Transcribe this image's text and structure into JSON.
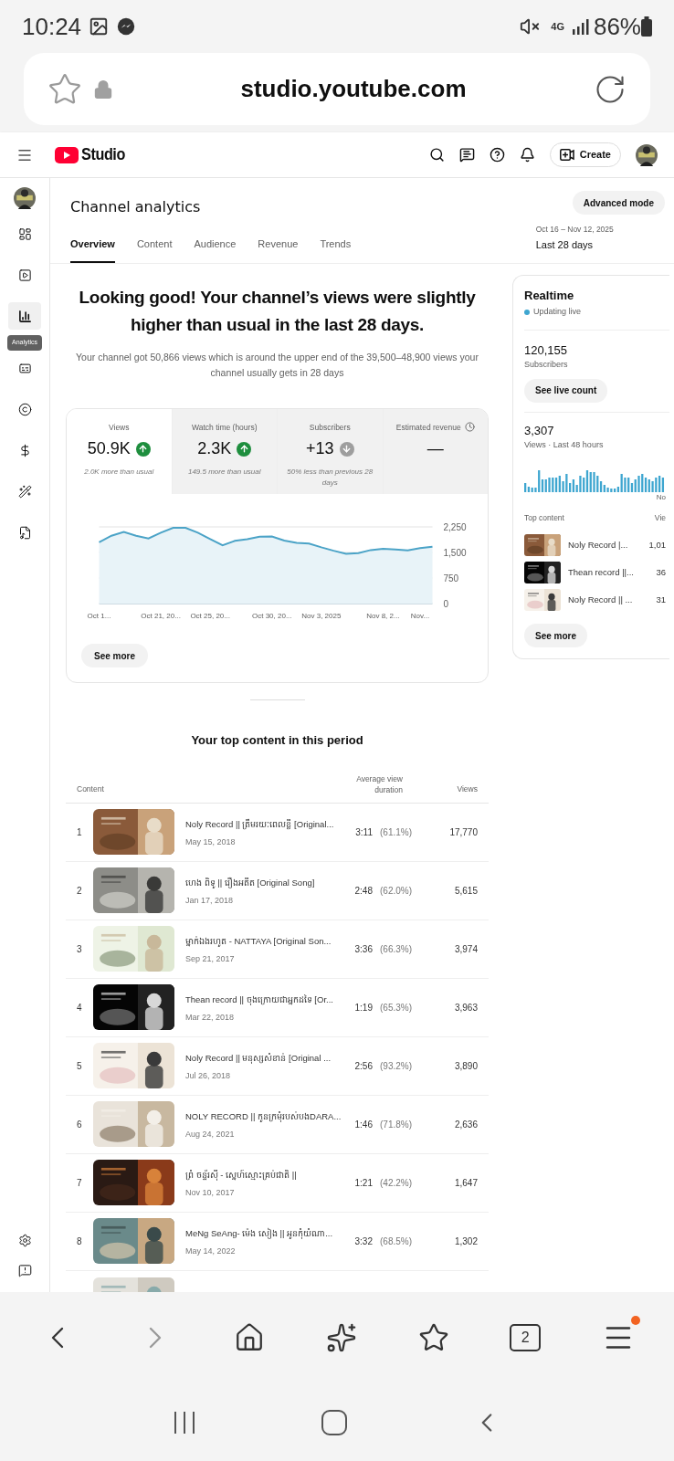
{
  "status_bar": {
    "time": "10:24",
    "network": "4G",
    "battery": "86%"
  },
  "address_bar": {
    "url": "studio.youtube.com"
  },
  "header": {
    "logo": "Studio",
    "create_button": "Create"
  },
  "sidebar": {
    "tooltip": "Analytics",
    "items": [
      {
        "kind": "dashboard",
        "selected": false
      },
      {
        "kind": "content",
        "selected": false
      },
      {
        "kind": "analytics",
        "selected": true
      },
      {
        "kind": "subtitles",
        "selected": false
      },
      {
        "kind": "copyright",
        "selected": false
      },
      {
        "kind": "earn",
        "selected": false
      },
      {
        "kind": "customization",
        "selected": false
      },
      {
        "kind": "audio",
        "selected": false
      }
    ],
    "footer_items": [
      {
        "kind": "settings"
      },
      {
        "kind": "feedback"
      }
    ]
  },
  "page": {
    "title": "Channel analytics",
    "advanced_button": "Advanced mode",
    "date_range": "Oct 16 – Nov 12, 2025",
    "period": "Last 28 days",
    "tabs": [
      {
        "label": "Overview",
        "selected": true
      },
      {
        "label": "Content",
        "selected": false
      },
      {
        "label": "Audience",
        "selected": false
      },
      {
        "label": "Revenue",
        "selected": false
      },
      {
        "label": "Trends",
        "selected": false
      }
    ]
  },
  "summary": {
    "headline": "Looking good! Your channel’s views were slightly higher than usual in the last 28 days.",
    "description": "Your channel got 50,866 views which is around the upper end of the 39,500–48,900 views your channel usually gets in 28 days"
  },
  "stats": [
    {
      "label": "Views",
      "value": "50.9K",
      "rising": true,
      "falling": false,
      "note": "2.0K more than usual",
      "clock": false,
      "selected": true
    },
    {
      "label": "Watch time (hours)",
      "value": "2.3K",
      "rising": true,
      "falling": false,
      "note": "149.5 more than usual",
      "clock": false,
      "selected": false
    },
    {
      "label": "Subscribers",
      "value": "+13",
      "rising": false,
      "falling": true,
      "note": "50% less than previous 28 days",
      "clock": false,
      "selected": false
    },
    {
      "label": "Estimated revenue",
      "value": "—",
      "rising": false,
      "falling": false,
      "clock": true,
      "selected": false
    }
  ],
  "chart_data": {
    "type": "area",
    "categories": [
      "Oct 1...",
      null,
      null,
      null,
      null,
      "Oct 21, 20...",
      null,
      null,
      null,
      "Oct 25, 20...",
      null,
      null,
      null,
      null,
      "Oct 30, 20...",
      null,
      null,
      null,
      "Nov 3, 2025",
      null,
      null,
      null,
      null,
      "Nov 8, 2...",
      null,
      null,
      "Nov...",
      null
    ],
    "series": [
      {
        "color": "#4ba3c7",
        "values": [
          1800,
          1990,
          2100,
          1990,
          1910,
          2080,
          2220,
          2220,
          2080,
          1890,
          1710,
          1840,
          1890,
          1960,
          1970,
          1850,
          1780,
          1760,
          1650,
          1550,
          1460,
          1480,
          1570,
          1610,
          1590,
          1560,
          1630,
          1670
        ]
      }
    ],
    "ylim": [
      0,
      2250
    ],
    "yticks": [
      {
        "value": 0,
        "label": "0"
      },
      {
        "value": 750,
        "label": "750"
      },
      {
        "value": 1500,
        "label": "1,500"
      },
      {
        "value": 2250,
        "label": "2,250"
      }
    ]
  },
  "see_more": "See more",
  "realtime": {
    "title": "Realtime",
    "status": "Updating live",
    "subscribers": "120,155",
    "subscribers_label": "Subscribers",
    "live_button": "See live count",
    "views": "3,307",
    "views_label": "Views · Last 48 hours",
    "axis_label": "No",
    "columns": [
      "Top content",
      "Vie"
    ],
    "rows": [
      {
        "title": "Noly Record |...",
        "views": "1,01"
      },
      {
        "title": "Thean record ||...",
        "views": "36"
      },
      {
        "title": "Noly Record || ...",
        "views": "31"
      }
    ],
    "see_more": "See more"
  },
  "top_content": {
    "title": "Your top content in this period",
    "columns": [
      "Content",
      "Average view duration",
      "Views"
    ],
    "rows": [
      {
        "rank": "1",
        "title": "Noly Record || ត្រឹមរយៈពេលខ្លី [Original...",
        "date": "May 15, 2018",
        "duration": "3:11",
        "percent": "(61.1%)",
        "views": "17,770"
      },
      {
        "rank": "2",
        "title": "ហេង ពិទូ || រឿងអតីត [Original Song]",
        "date": "Jan 17, 2018",
        "duration": "2:48",
        "percent": "(62.0%)",
        "views": "5,615"
      },
      {
        "rank": "3",
        "title": "ម្នាក់ឯងរហូត - NATTAYA [Original Son...",
        "date": "Sep 21, 2017",
        "duration": "3:36",
        "percent": "(66.3%)",
        "views": "3,974"
      },
      {
        "rank": "4",
        "title": "Thean record || ចុងក្រោយជាអ្នកដទៃ [Or...",
        "date": "Mar 22, 2018",
        "duration": "1:19",
        "percent": "(65.3%)",
        "views": "3,963"
      },
      {
        "rank": "5",
        "title": "Noly Record || មនុស្សសំខាន់ [Original ...",
        "date": "Jul 26, 2018",
        "duration": "2:56",
        "percent": "(93.2%)",
        "views": "3,890"
      },
      {
        "rank": "6",
        "title": "NOLY RECORD || កូនក្រមុំរបស់បងDARA...",
        "date": "Aug 24, 2021",
        "duration": "1:46",
        "percent": "(71.8%)",
        "views": "2,636"
      },
      {
        "rank": "7",
        "title": "ព្រំ ចន្ទ័រស៊ី - ស្នេហ៍ស្មោះគ្រប់ជាតិ ||",
        "date": "Nov 10, 2017",
        "duration": "1:21",
        "percent": "(42.2%)",
        "views": "1,647"
      },
      {
        "rank": "8",
        "title": "MeNg SeAng- ម៉េង សៀង || អូនកុំយំណា...",
        "date": "May 14, 2022",
        "duration": "3:32",
        "percent": "(68.5%)",
        "views": "1,302"
      }
    ]
  },
  "browser_nav": {
    "tabs_count": "2",
    "notification": true
  }
}
